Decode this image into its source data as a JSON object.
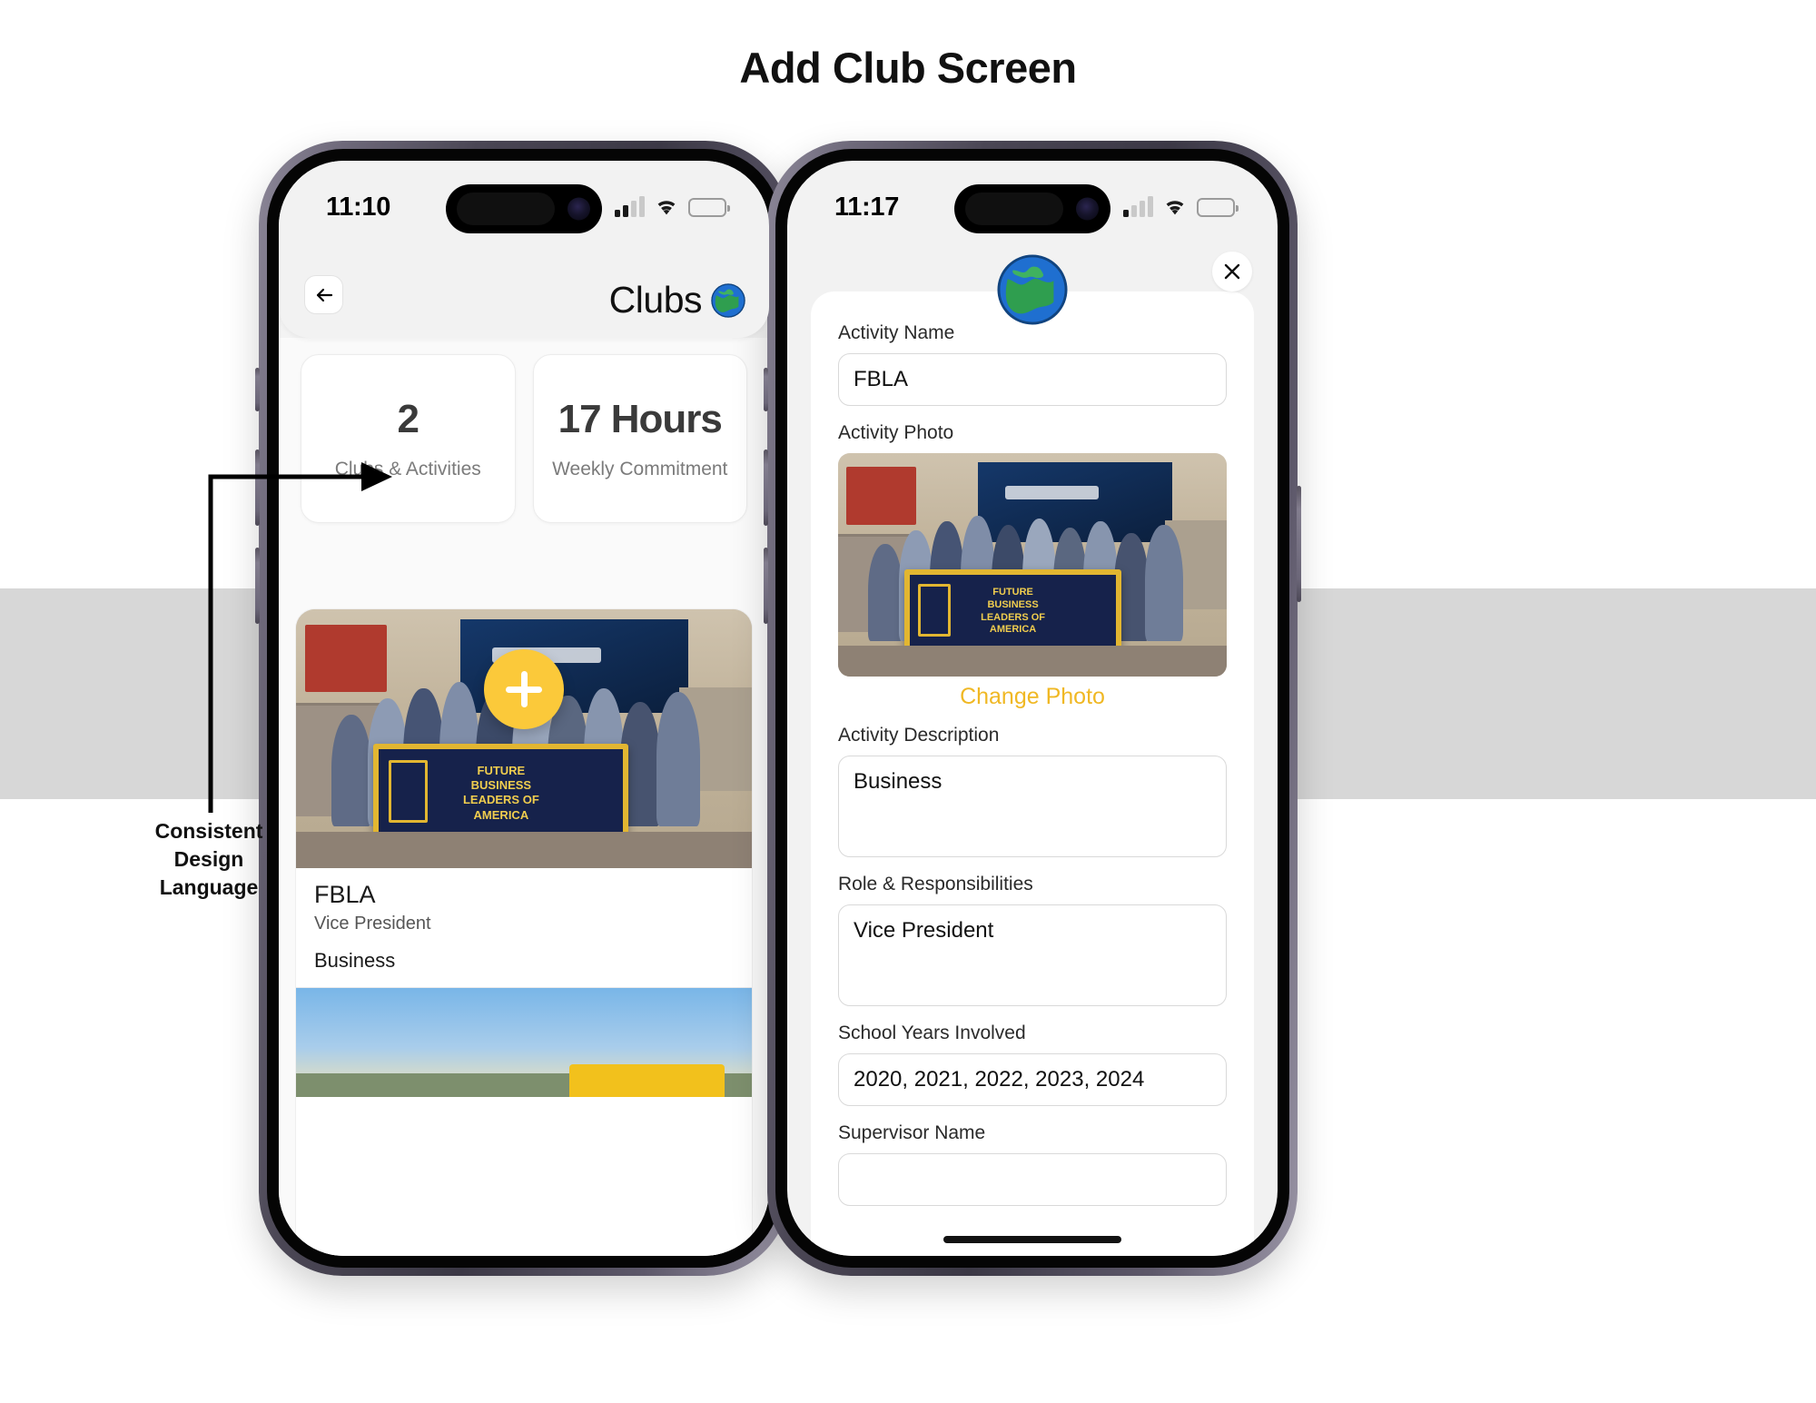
{
  "page": {
    "title": "Add Club Screen",
    "annotation": "Consistent\nDesign\nLanguage",
    "annotation_lines": [
      "Consistent",
      "Design",
      "Language"
    ]
  },
  "colors": {
    "accent_yellow": "#fbc93a",
    "change_photo_yellow": "#f0b824",
    "battery_low_power": "#f5c518",
    "battery_critical": "#ff3b30",
    "band_grey": "#d7d7d7",
    "phone_frame": "#4a4654"
  },
  "phone_left": {
    "status": {
      "time": "11:10",
      "signal_bars_filled": 2,
      "signal_bars_total": 4,
      "wifi": "wifi-icon",
      "battery_fill_percent": 22,
      "battery_color": "#f5c518"
    },
    "header": {
      "back_icon": "arrow-left-icon",
      "title": "Clubs",
      "title_emoji": "globe-icon"
    },
    "stats": [
      {
        "value": "2",
        "label": "Clubs & Activities"
      },
      {
        "value": "17 Hours",
        "label": "Weekly Commitment"
      }
    ],
    "fab": {
      "icon": "plus-icon",
      "label": "Add"
    },
    "club_cards": [
      {
        "photo_alt": "FBLA club group photo with banner",
        "banner_lines": [
          "FUTURE",
          "BUSINESS",
          "LEADERS OF",
          "AMERICA"
        ],
        "title": "FBLA",
        "role": "Vice President",
        "description": "Business"
      },
      {
        "photo_alt": "Outdoor sky and field photo"
      }
    ]
  },
  "phone_right": {
    "status": {
      "time": "11:17",
      "signal_bars_filled": 1,
      "signal_bars_total": 4,
      "wifi": "wifi-icon",
      "battery_fill_percent": 14,
      "battery_color": "#ff3b30"
    },
    "close_icon": "close-icon",
    "globe_icon": "globe-icon",
    "form": {
      "fields": [
        {
          "label": "Activity Name",
          "value": "FBLA",
          "type": "text"
        },
        {
          "label": "Activity Photo",
          "type": "photo",
          "action": "Change Photo"
        },
        {
          "label": "Activity Description",
          "value": "Business",
          "type": "textarea"
        },
        {
          "label": "Role & Responsibilities",
          "value": "Vice President",
          "type": "textarea"
        },
        {
          "label": "School Years Involved",
          "value": "2020, 2021, 2022, 2023, 2024",
          "type": "text"
        },
        {
          "label": "Supervisor Name",
          "value": "",
          "type": "text"
        }
      ],
      "banner_lines": [
        "FUTURE",
        "BUSINESS",
        "LEADERS OF",
        "AMERICA"
      ]
    }
  }
}
